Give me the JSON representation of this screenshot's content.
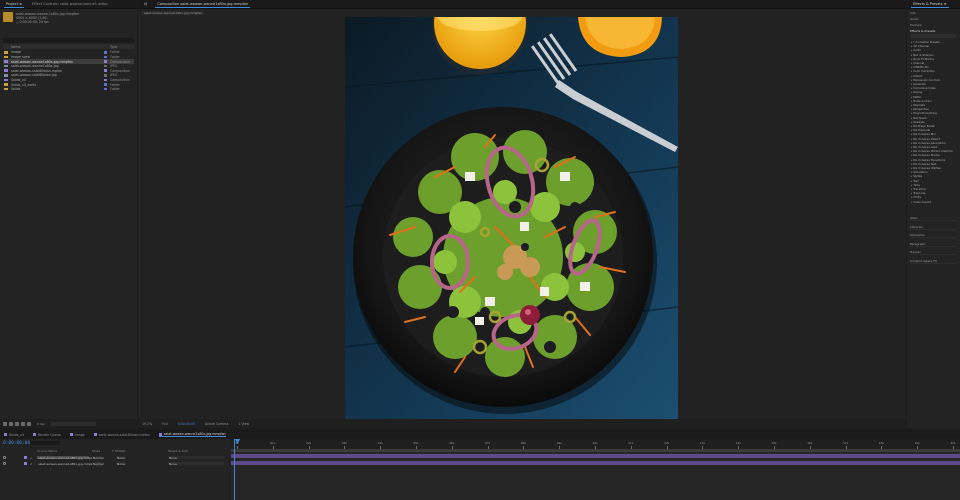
{
  "project": {
    "tabs": [
      "Project ≡",
      "Effect Controls: salat-wowan-wanne1.webp"
    ],
    "preview_lines": [
      "salat-wowan-wanne-1x80x.jpg.mmpfan",
      "4000 × 6000 (1,00)",
      "△ 0:00:00:00, 24 fps"
    ],
    "columns": {
      "name": "Name",
      "type": "Type"
    },
    "items": [
      {
        "name": "Image",
        "type": "Folder",
        "icon": "folder-icon",
        "label_color": "#5b6fd0",
        "selected": false
      },
      {
        "name": "Image spesi",
        "type": "Folder",
        "icon": "folder-icon",
        "label_color": "#5b6fd0",
        "selected": false
      },
      {
        "name": "salat-wowan-wanne1x80x.jpg.mmpfan",
        "type": "Composition",
        "icon": "composition-icon",
        "label_color": "#8f7bd6",
        "selected": true
      },
      {
        "name": "salat-wowan-wanne1x80x.jpg",
        "type": "JPEG",
        "icon": "image-icon",
        "label_color": "#6c6c6c",
        "selected": false
      },
      {
        "name": "salat-wowan-salat80alan.mpfan",
        "type": "Composition",
        "icon": "composition-icon",
        "label_color": "#8f7bd6",
        "selected": false
      },
      {
        "name": "salat-wowan-salat80alan.jpg",
        "type": "JPEG",
        "icon": "image-icon",
        "label_color": "#6c6c6c",
        "selected": false
      },
      {
        "name": "Solids_v4",
        "type": "Composition",
        "icon": "composition-icon",
        "label_color": "#8f7bd6",
        "selected": false
      },
      {
        "name": "Solids_v4_asets",
        "type": "Folder",
        "icon": "folder-icon",
        "label_color": "#5b6fd0",
        "selected": false
      },
      {
        "name": "Solids",
        "type": "Folder",
        "icon": "folder-icon",
        "label_color": "#5b6fd0",
        "selected": false
      }
    ],
    "bpc": "8 bpc"
  },
  "viewer": {
    "tabs": [
      "Composition",
      "salat-wowan-wanne1x80x.jpg.mmpfan"
    ],
    "sub_tab": "salat-wowan-wanne1x80x.jpg.mmpfan",
    "zoom": "19,2%",
    "resolution": "Full",
    "time": "0:00:00:00",
    "camera": "Active Camera",
    "views": "1 View"
  },
  "effects": {
    "tabs": [
      "Effects & Presets ≡"
    ],
    "sections": [
      "Info",
      "Audio",
      "Preview"
    ],
    "preset_label": "Effects & Presets",
    "items": [
      "* Animation Presets",
      "3D Channel",
      "Audio",
      "Blur & Sharpen",
      "Boris FX Mocha",
      "Channel",
      "CINEMA 4D",
      "Color Correction",
      "Distort",
      "Expression Controls",
      "Generate",
      "Immersive Video",
      "Keying",
      "Matte",
      "Noise & Grain",
      "Obsolete",
      "Perspective",
      "Plugin Everything",
      "Red Giant",
      "Rowbyte",
      "RG Magic Bullet",
      "RG Trapcode",
      "RG Universe Blur",
      "RG Universe Distort",
      "RG Universe Generators",
      "RG Universe Glow",
      "RG Universe Motion Graphics",
      "RG Universe Stylize",
      "RG Universe Transitions",
      "RG Universe Text",
      "RG Universe Utilities",
      "Simulation",
      "Stylize",
      "Text",
      "Time",
      "Transition",
      "Trapcode",
      "Utility",
      "Video Copilot"
    ],
    "lower_sections": [
      "Align",
      "Libraries",
      "Character",
      "Paragraph",
      "Tracker",
      "Content-Aware Fill"
    ]
  },
  "timeline": {
    "tabs": [
      {
        "label": "Solids_v4",
        "color": "#8b7ad6",
        "active": false
      },
      {
        "label": "Render Queue",
        "color": "#8b7ad6",
        "active": false
      },
      {
        "label": "Image",
        "color": "#8b7ad6",
        "active": false
      },
      {
        "label": "salat-wowan-salat80alan.mpfan",
        "color": "#8b7ad6",
        "active": false
      },
      {
        "label": "salat-wowan-wanne1x80x.jpg.mmpfan",
        "color": "#8b7ad6",
        "active": true
      }
    ],
    "timecode": "0:00:00:00",
    "headers": {
      "source": "Source Name",
      "mode": "Mode",
      "trkmat": "T TrkMat",
      "parent": "Parent & Link"
    },
    "layers": [
      {
        "num": "1",
        "name": "salat-wowan-wanne1x80x.jpg.mmpfan",
        "mode": "Normal",
        "trkmat": "None",
        "parent": "None",
        "label_color": "#8f7bd6"
      },
      {
        "num": "2",
        "name": "salat-wowan-wanne1x80x.jpg.mmpfan.jpg",
        "mode": "Normal",
        "trkmat": "None",
        "parent": "None",
        "label_color": "#8f7bd6"
      }
    ],
    "ruler_labels": [
      "0s",
      "01s",
      "02s",
      "03s",
      "04s",
      "05s",
      "06s",
      "07s",
      "08s",
      "09s",
      "10s",
      "11s",
      "12s",
      "13s",
      "14s",
      "15s",
      "16s",
      "17s",
      "18s",
      "19s",
      "20s"
    ]
  },
  "colors": {
    "accent": "#3d8bd8",
    "layer_bar": "#5e4a8a",
    "composition_label": "#8f7bd6"
  }
}
